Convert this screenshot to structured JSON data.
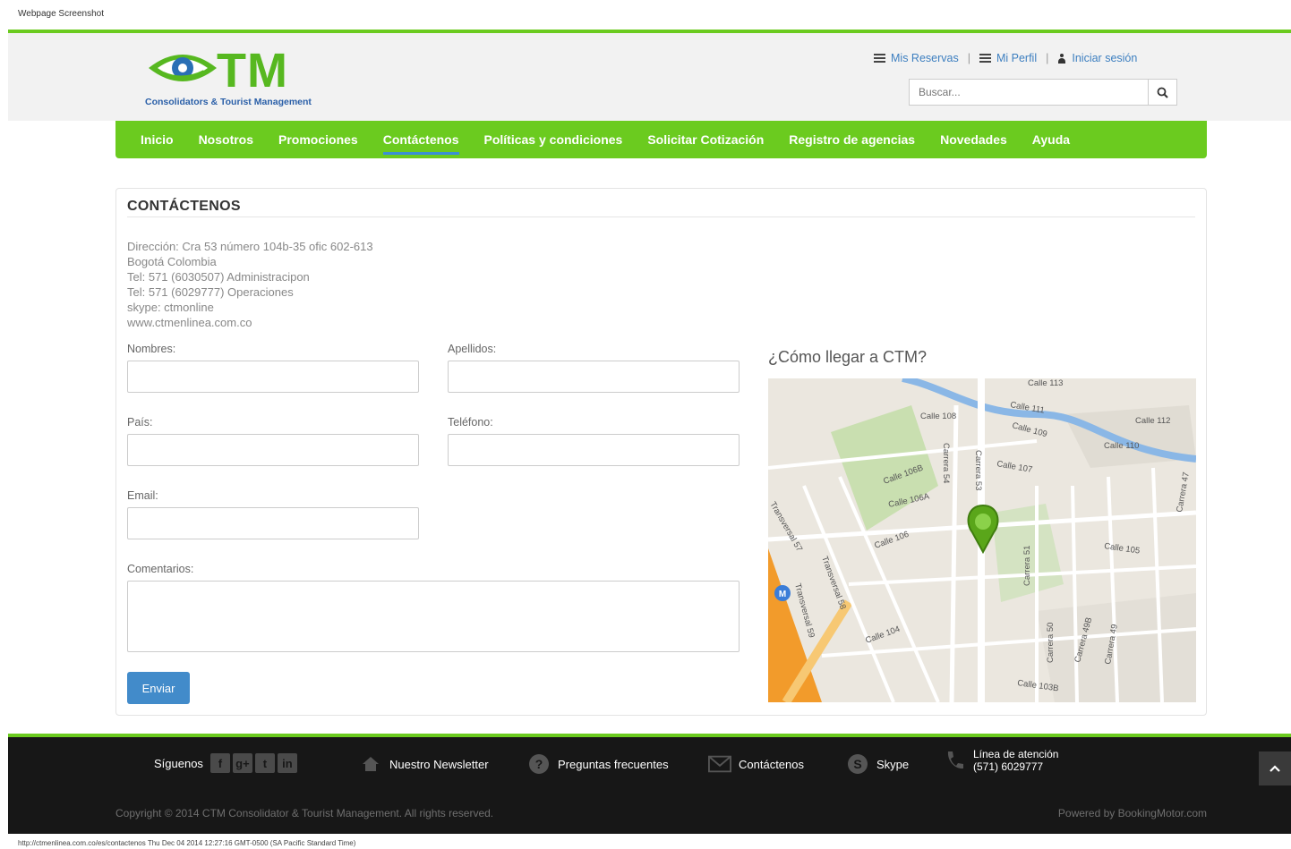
{
  "caption": "Webpage Screenshot",
  "logo": {
    "title": "TM",
    "subtitle": "Consolidators & Tourist Management"
  },
  "top_links": {
    "reservations": "Mis Reservas",
    "profile": "Mi Perfil",
    "login": "Iniciar sesión",
    "separator": "|"
  },
  "search": {
    "placeholder": "Buscar..."
  },
  "nav": {
    "items": [
      "Inicio",
      "Nosotros",
      "Promociones",
      "Contáctenos",
      "Políticas y condiciones",
      "Solicitar Cotización",
      "Registro de agencias",
      "Novedades",
      "Ayuda"
    ],
    "active_index": 3
  },
  "contact": {
    "title": "CONTÁCTENOS",
    "address_lines": [
      "Dirección: Cra 53 número 104b-35 ofic 602-613",
      "Bogotá Colombia",
      "Tel: 571 (6030507) Administracipon",
      "Tel: 571 (6029777) Operaciones",
      "skype: ctmonline",
      "www.ctmenlinea.com.co"
    ],
    "form": {
      "first_name": "Nombres:",
      "last_name": "Apellidos:",
      "country": "País:",
      "phone": "Teléfono:",
      "email": "Email:",
      "comments": "Comentarios:",
      "submit": "Enviar"
    },
    "map_title": "¿Cómo llegar a CTM?",
    "map_labels": [
      "Calle 113",
      "Calle 111",
      "Calle 109",
      "Calle 108",
      "Calle 107",
      "Calle 106B",
      "Calle 106A",
      "Calle 106",
      "Calle 105",
      "Calle 104",
      "Calle 103B",
      "Carrera 54",
      "Carrera 53",
      "Carrera 51",
      "Carrera 50",
      "Carrera 49B",
      "Carrera 49",
      "Carrera 47",
      "Transversal 57",
      "Transversal 58",
      "Transversal 59",
      "Calle 112",
      "Calle 110"
    ]
  },
  "footer": {
    "follow": "Síguenos",
    "social": [
      "f",
      "g+",
      "t",
      "in"
    ],
    "newsletter": "Nuestro Newsletter",
    "faq": "Preguntas frecuentes",
    "contact": "Contáctenos",
    "skype": "Skype",
    "helpline_label": "Línea de atención",
    "helpline_number": "(571) 6029777",
    "copyright": "Copyright © 2014 CTM Consolidator & Tourist Management. All rights reserved.",
    "powered": "Powered by BookingMotor.com"
  },
  "status_url": "http://ctmenlinea.com.co/es/contactenos Thu Dec 04 2014 12:27:16 GMT-0500 (SA Pacific Standard Time)",
  "colors": {
    "green": "#6bcb1f",
    "blue": "#428bca",
    "footer": "#171717"
  }
}
